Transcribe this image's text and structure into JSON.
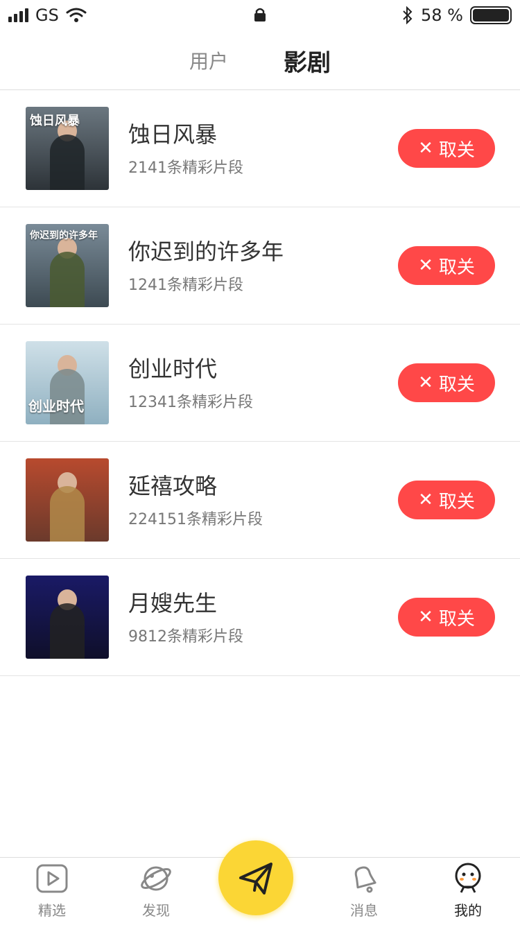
{
  "status_bar": {
    "carrier": "GS",
    "battery_text": "58 %"
  },
  "tabs": [
    {
      "label": "用户",
      "active": false
    },
    {
      "label": "影剧",
      "active": true
    }
  ],
  "items": [
    {
      "title": "蚀日风暴",
      "subtitle": "2141条精彩片段",
      "action": "取关",
      "thumb_text": "蚀日风暴",
      "thumb_colors": [
        "#5f6a73",
        "#2d3338"
      ]
    },
    {
      "title": "你迟到的许多年",
      "subtitle": "1241条精彩片段",
      "action": "取关",
      "thumb_text": "你迟到的许多年",
      "thumb_colors": [
        "#6f8190",
        "#3d4a52"
      ]
    },
    {
      "title": "创业时代",
      "subtitle": "12341条精彩片段",
      "action": "取关",
      "thumb_text": "创业时代",
      "thumb_colors": [
        "#bcd3dd",
        "#2d4b72"
      ]
    },
    {
      "title": "延禧攻略",
      "subtitle": "224151条精彩片段",
      "action": "取关",
      "thumb_text": "",
      "thumb_colors": [
        "#b84a2e",
        "#6b3a2c"
      ]
    },
    {
      "title": "月嫂先生",
      "subtitle": "9812条精彩片段",
      "action": "取关",
      "thumb_text": "",
      "thumb_colors": [
        "#1a1a66",
        "#0f0f2a"
      ]
    }
  ],
  "bottom_nav": [
    {
      "label": "精选",
      "icon": "play-icon",
      "active": false
    },
    {
      "label": "发现",
      "icon": "planet-icon",
      "active": false
    },
    {
      "label": "",
      "icon": "send-icon",
      "active": false
    },
    {
      "label": "消息",
      "icon": "bell-icon",
      "active": false
    },
    {
      "label": "我的",
      "icon": "profile-face-icon",
      "active": true
    }
  ],
  "colors": {
    "accent": "#FBD635",
    "unfollow": "#FF4848"
  }
}
